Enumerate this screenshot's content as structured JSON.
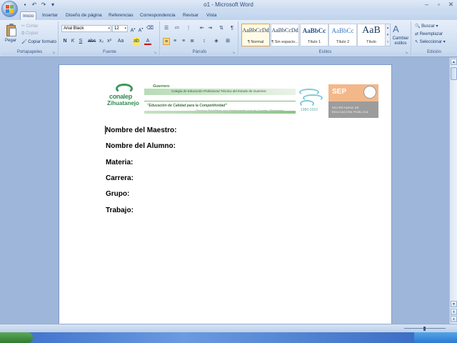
{
  "app": {
    "title": "o1 - Microsoft Word"
  },
  "tabs": [
    {
      "label": "Inicio",
      "active": true
    },
    {
      "label": "Insertar"
    },
    {
      "label": "Diseño de página"
    },
    {
      "label": "Referencias"
    },
    {
      "label": "Correspondencia"
    },
    {
      "label": "Revisar"
    },
    {
      "label": "Vista"
    }
  ],
  "clipboard": {
    "paste_label": "Pegar",
    "cut_label": "Cortar",
    "copy_label": "Copiar",
    "format_label": "Copiar formato",
    "group_label": "Portapapeles"
  },
  "font": {
    "font_name": "Arial Black",
    "font_size": "12",
    "group_label": "Fuente"
  },
  "paragraph": {
    "group_label": "Párrafo"
  },
  "styles": {
    "items": [
      {
        "sample": "AaBbCcDd",
        "name": "¶ Normal",
        "selected": true
      },
      {
        "sample": "AaBbCcDd",
        "name": "¶ Sin espacio..."
      },
      {
        "sample": "AaBbCc",
        "name": "Título 1"
      },
      {
        "sample": "AaBbCc",
        "name": "Título 2"
      },
      {
        "sample": "AaB",
        "name": "Título"
      }
    ],
    "change_label": "Cambiar estilos",
    "group_label": "Estilos"
  },
  "editing": {
    "find_label": "Buscar",
    "replace_label": "Reemplazar",
    "select_label": "Seleccionar",
    "group_label": "Edición"
  },
  "header": {
    "conalep_line1": "conalep",
    "conalep_line2": "Zihuatanejo",
    "banner_state": "Guerrero",
    "banner_college": "Colegio de Educación Profesional Técnica del Estado de Guerrero",
    "banner_slogan": "\"Educación de Calidad para la Competitividad\"",
    "banner_tagline": "Técnicos Bachilleres para Profesionales sólo en Conalep Zihuatanejo",
    "emblem_years": "1980-2010",
    "sep_word": "SEP",
    "sep_line1": "SECRETARÍA DE",
    "sep_line2": "EDUCACIÓN PÚBLICA"
  },
  "document": {
    "fields": [
      "Nombre del Maestro:",
      "Nombre del Alumno:",
      "Materia:",
      "Carrera:",
      "Grupo:",
      "Trabajo:"
    ]
  },
  "colors": {
    "ribbon": "#d3e1f3",
    "background": "#9eb6d9",
    "page": "#ffffff",
    "conalep_green": "#2f8a4f",
    "sep_orange": "#f3b88a"
  }
}
